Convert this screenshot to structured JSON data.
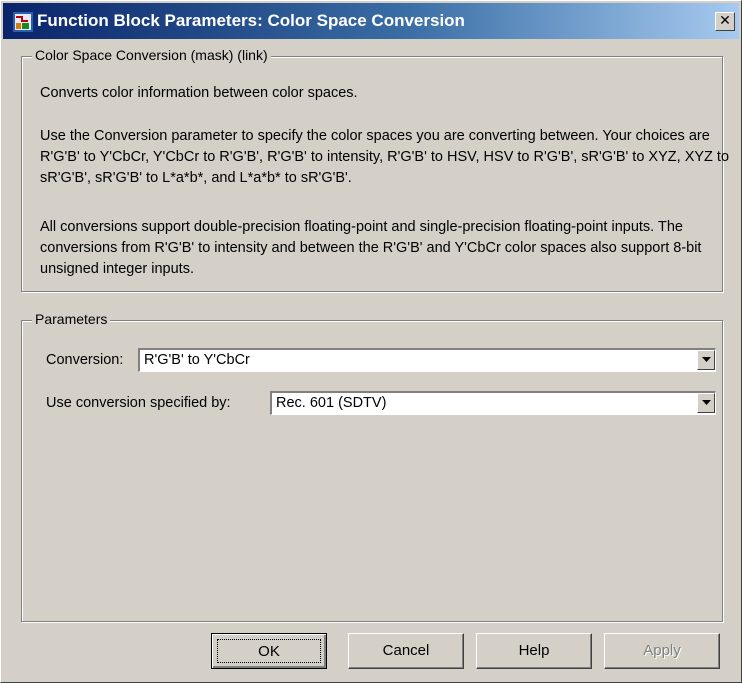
{
  "window": {
    "title": "Function Block Parameters: Color Space  Conversion",
    "close_glyph": "✕"
  },
  "mask_group": {
    "legend": "Color Space Conversion (mask) (link)",
    "paragraphs": [
      "Converts color information between color spaces.",
      "Use the Conversion parameter to specify the color spaces you are converting between. Your choices are R'G'B' to Y'CbCr, Y'CbCr to R'G'B', R'G'B' to intensity, R'G'B' to HSV, HSV to R'G'B', sR'G'B' to XYZ, XYZ to sR'G'B', sR'G'B' to L*a*b*, and L*a*b* to sR'G'B'.",
      "All conversions support double-precision floating-point and single-precision floating-point inputs. The conversions from R'G'B' to intensity and between the R'G'B' and Y'CbCr color spaces also support 8-bit unsigned integer inputs."
    ]
  },
  "parameters_group": {
    "legend": "Parameters",
    "conversion": {
      "label": "Conversion:",
      "value": "R'G'B' to Y'CbCr"
    },
    "specified_by": {
      "label": "Use conversion specified by:",
      "value": "Rec. 601 (SDTV)"
    }
  },
  "buttons": {
    "ok": "OK",
    "cancel": "Cancel",
    "help": "Help",
    "apply": "Apply"
  },
  "colors": {
    "titlebar_start": "#0a246a",
    "titlebar_end": "#a6caf0",
    "face": "#d4d0c8"
  },
  "icons": [
    "simulink-block-icon",
    "close-icon",
    "dropdown-arrow-icon"
  ]
}
